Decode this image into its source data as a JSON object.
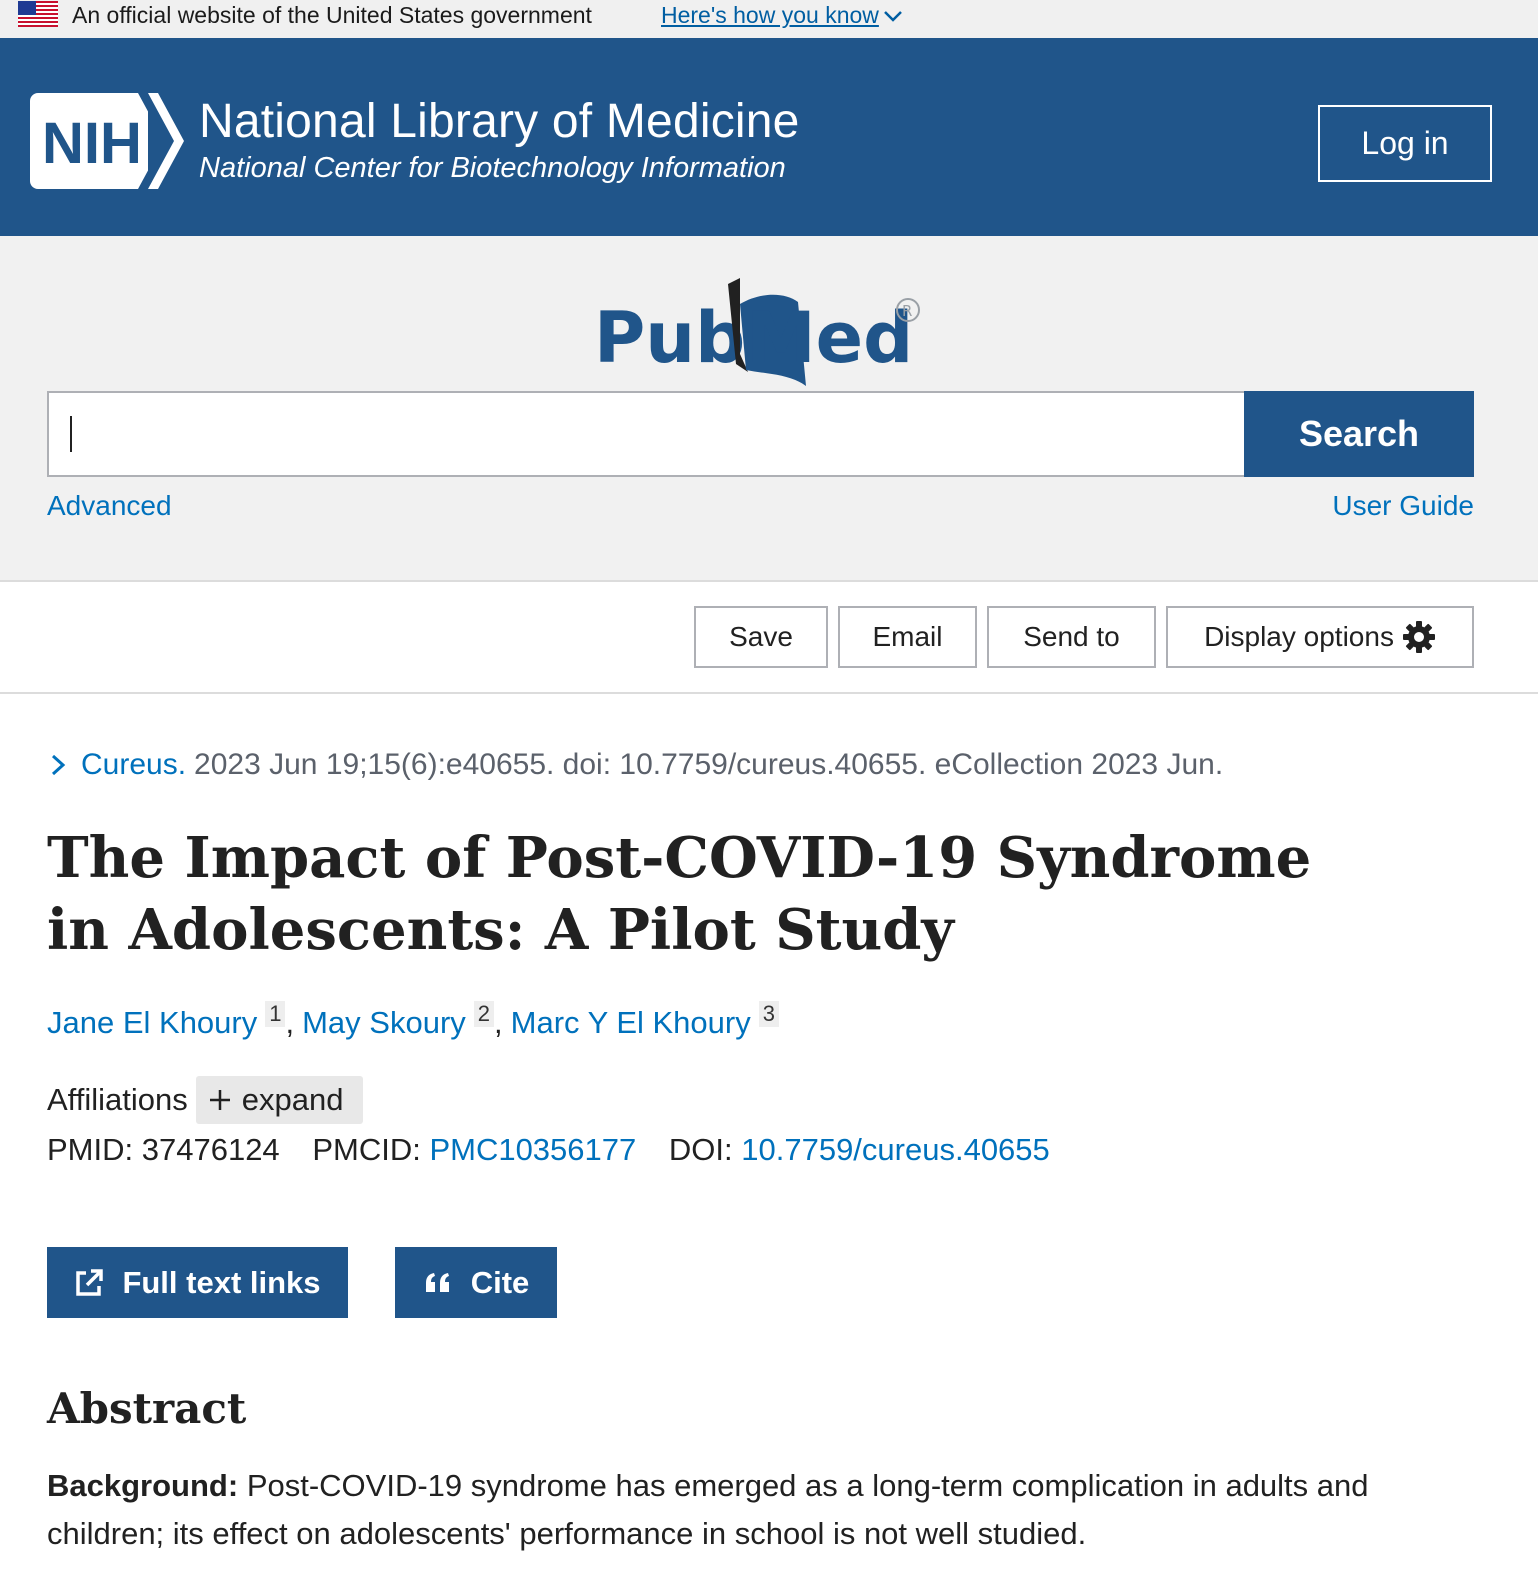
{
  "gov_banner": {
    "text": "An official website of the United States government",
    "link": "Here's how you know"
  },
  "header": {
    "logo_text": "NIH",
    "title": "National Library of Medicine",
    "subtitle": "National Center for Biotechnology Information",
    "login_label": "Log in"
  },
  "search": {
    "logo_text": "PubMed",
    "value": "",
    "button_label": "Search",
    "advanced_label": "Advanced",
    "guide_label": "User Guide"
  },
  "actions": {
    "save": "Save",
    "email": "Email",
    "send_to": "Send to",
    "display_options": "Display options"
  },
  "article": {
    "journal": "Cureus.",
    "citation_rest": "2023 Jun 19;15(6):e40655. doi: 10.7759/cureus.40655. eCollection 2023 Jun.",
    "title": "The Impact of Post-COVID-19 Syndrome in Adolescents: A Pilot Study",
    "authors": [
      {
        "name": "Jane El Khoury",
        "aff": "1"
      },
      {
        "name": "May Skoury",
        "aff": "2"
      },
      {
        "name": "Marc Y El Khoury",
        "aff": "3"
      }
    ],
    "affiliations_label": "Affiliations",
    "expand_label": "expand",
    "pmid_label": "PMID:",
    "pmid": "37476124",
    "pmcid_label": "PMCID:",
    "pmcid": "PMC10356177",
    "doi_label": "DOI:",
    "doi": "10.7759/cureus.40655",
    "full_text_label": "Full text links",
    "cite_label": "Cite",
    "abstract_heading": "Abstract",
    "background_label": "Background:",
    "background_text": "Post-COVID-19 syndrome has emerged as a long-term complication in adults and children; its effect on adolescents' performance in school is not well studied."
  },
  "colors": {
    "nih_blue": "#20558a",
    "link_blue": "#0071bc"
  }
}
